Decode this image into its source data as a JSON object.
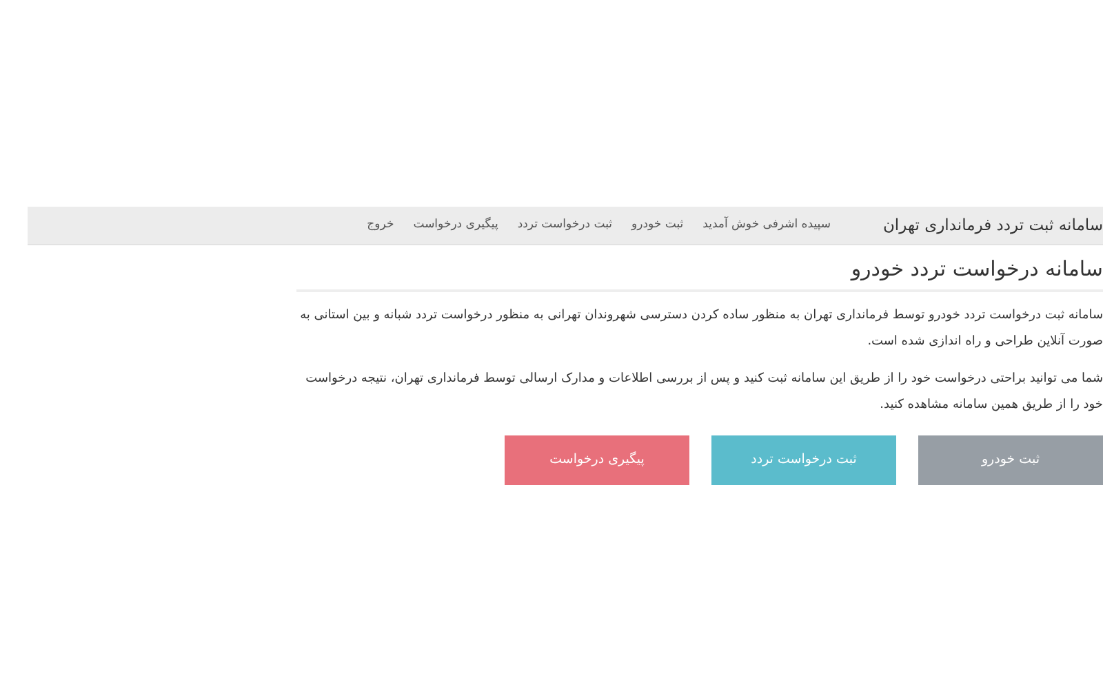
{
  "navbar": {
    "brand": "سامانه ثبت تردد فرمانداری تهران",
    "items": [
      {
        "label": "سپیده اشرفی خوش آمدید"
      },
      {
        "label": "ثبت خودرو"
      },
      {
        "label": "ثبت درخواست تردد"
      },
      {
        "label": "پیگیری درخواست"
      },
      {
        "label": "خروج"
      }
    ]
  },
  "page": {
    "title": "سامانه درخواست تردد خودرو",
    "paragraphs": [
      "سامانه ثبت درخواست تردد خودرو توسط فرمانداری تهران به منظور ساده کردن دسترسی شهروندان تهرانی به منظور درخواست تردد شبانه و بین استانی به صورت آنلاین طراحی و راه اندازی شده است.",
      "شما می توانید براحتی درخواست خود را از طریق این سامانه ثبت کنید و پس از بررسی اطلاعات و مدارک ارسالی توسط فرمانداری تهران، نتیجه درخواست خود را از طریق همین سامانه مشاهده کنید."
    ],
    "buttons": [
      {
        "label": "ثبت خودرو",
        "color": "#979ea5"
      },
      {
        "label": "ثبت درخواست تردد",
        "color": "#5bbccc"
      },
      {
        "label": "پیگیری درخواست",
        "color": "#e8707b"
      }
    ]
  }
}
